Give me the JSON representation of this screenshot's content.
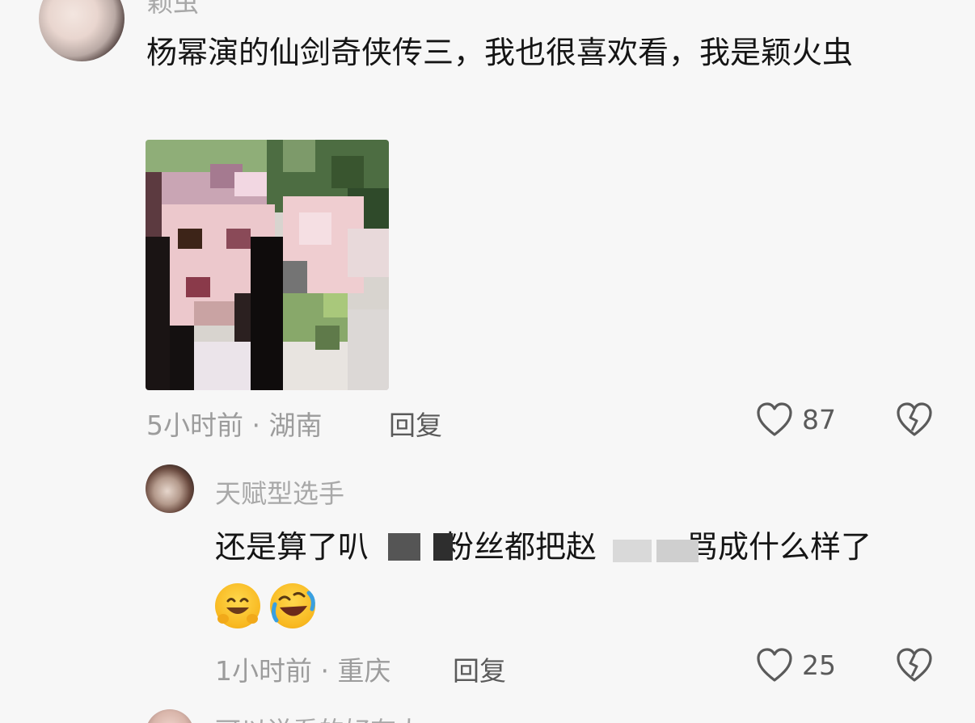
{
  "comments": [
    {
      "username": "颖虫",
      "text": "杨幂演的仙剑奇侠传三，我也很喜欢看，我是颖火虫",
      "time_location": "5小时前 · 湖南",
      "reply_label": "回复",
      "likes": "87",
      "image_present": true
    },
    {
      "username": "天赋型选手",
      "text": "还是算了叭",
      "text_middle": "粉丝都把赵",
      "text_end": "骂成什么样了",
      "emojis": [
        "grinning-face",
        "rolling-laughing-face"
      ],
      "time_location": "1小时前 · 重庆",
      "reply_label": "回复",
      "likes": "25"
    },
    {
      "username": "可以说看的好有人"
    }
  ],
  "icons": {
    "like": "heart-outline-icon",
    "dislike": "broken-heart-icon"
  },
  "colors": {
    "background": "#f7f7f7",
    "text": "#151515",
    "meta": "#9c9c9c",
    "username": "#a8a8a8"
  }
}
